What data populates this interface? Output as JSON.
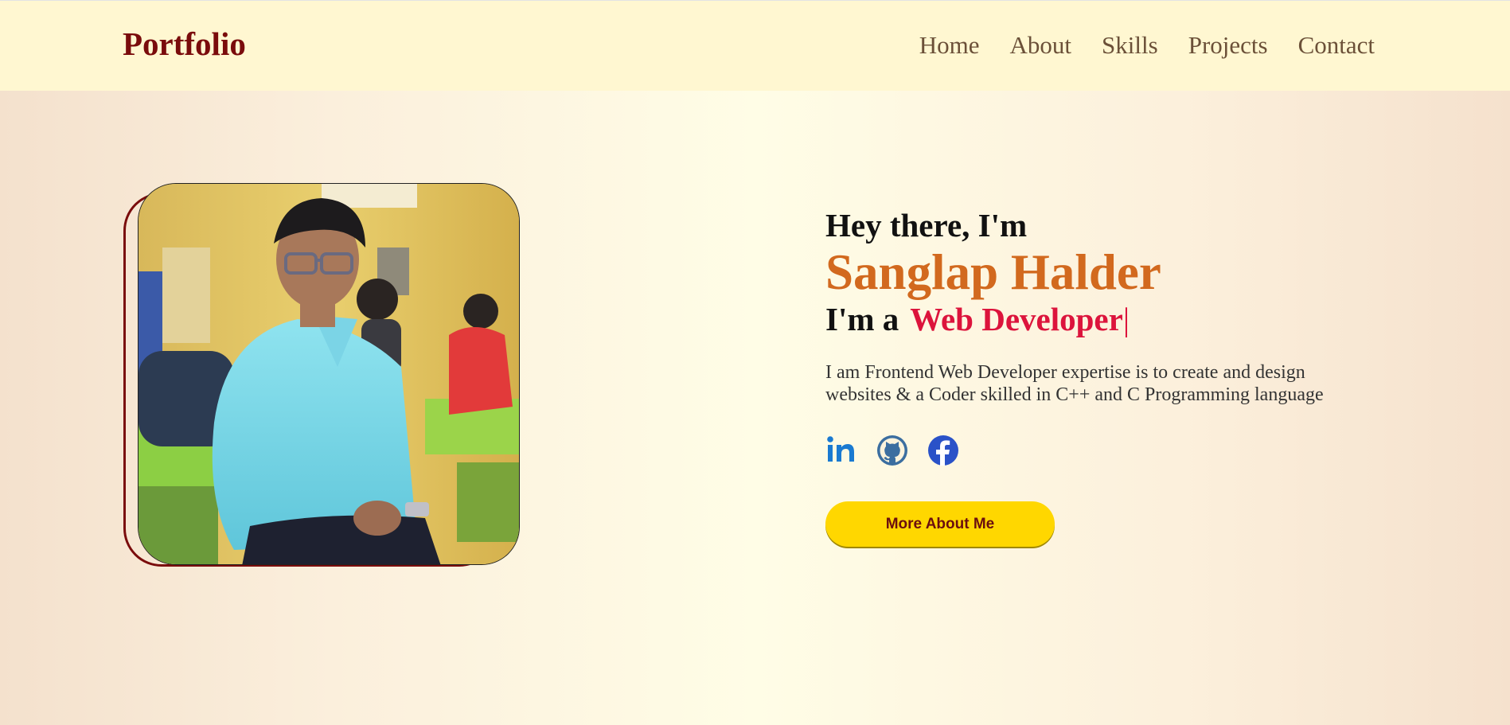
{
  "header": {
    "logo": "Portfolio",
    "nav": [
      "Home",
      "About",
      "Skills",
      "Projects",
      "Contact"
    ]
  },
  "hero": {
    "greeting": "Hey there, I'm",
    "name": "Sanglap Halder",
    "role_prefix": "I'm a",
    "role": "Web Developer",
    "cursor": "|",
    "description_line1": "I am Frontend Web Developer expertise is to create and design",
    "description_line2": "websites & a Coder skilled in C++ and C Programming language",
    "cta_label": "More About Me",
    "photo_alt": "Profile photo"
  },
  "socials": [
    "linkedin-icon",
    "github-icon",
    "facebook-icon"
  ],
  "colors": {
    "brand": "#7a0c0c",
    "name": "#d2691e",
    "role": "#dc143c",
    "cta": "#ffd700",
    "header_bg": "#fff7d1"
  }
}
